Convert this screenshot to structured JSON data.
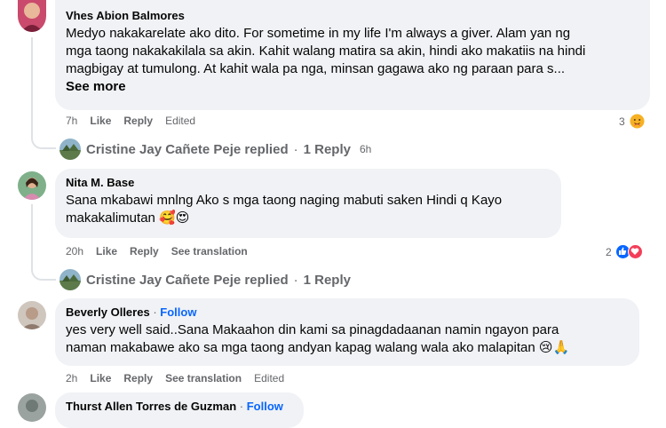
{
  "comments": [
    {
      "author": "Vhes Abion Balmores",
      "lines": [
        "Medyo nakakarelate ako dito. For sometime in my life I'm always a giver. Alam yan ng",
        "mga taong nakakakilala sa akin. Kahit walang matira sa akin, hindi ako makatiis na hindi",
        "magbigay at tumulong. At kahit wala pa nga, minsan gagawa ako ng paraan para s..."
      ],
      "see_more": "See more",
      "time": "7h",
      "like": "Like",
      "reply": "Reply",
      "extra": "Edited",
      "reaction_count": "3",
      "reply_summary": {
        "name": "Cristine Jay Cañete Peje replied",
        "sep": "·",
        "count": "1 Reply",
        "time": "6h"
      }
    },
    {
      "author": "Nita M. Base",
      "lines": [
        "Sana mkabawi mnlng Ako s mga taong naging mabuti saken Hindi q Kayo",
        "makakalimutan 🥰😍"
      ],
      "time": "20h",
      "like": "Like",
      "reply": "Reply",
      "extra": "See translation",
      "reaction_count": "2",
      "reply_summary": {
        "name": "Cristine Jay Cañete Peje replied",
        "sep": "·",
        "count": "1 Reply"
      }
    },
    {
      "author": "Beverly Olleres",
      "sep": "·",
      "follow": "Follow",
      "lines": [
        "yes very well said..Sana Makaahon din kami sa pinagdadaanan namin ngayon para",
        "naman makabawe ako sa mga taong andyan kapag walang wala ako malapitan 😢🙏"
      ],
      "time": "2h",
      "like": "Like",
      "reply": "Reply",
      "extra": "See translation",
      "extra2": "Edited"
    },
    {
      "author": "Thurst Allen Torres de Guzman",
      "sep": "·",
      "follow": "Follow"
    }
  ],
  "colors": {
    "bubble": "#f0f2f5",
    "secondary_text": "#65676b",
    "link_blue": "#0866ff"
  },
  "icons": [
    "care-reaction-icon",
    "like-reaction-icon",
    "love-reaction-icon"
  ]
}
